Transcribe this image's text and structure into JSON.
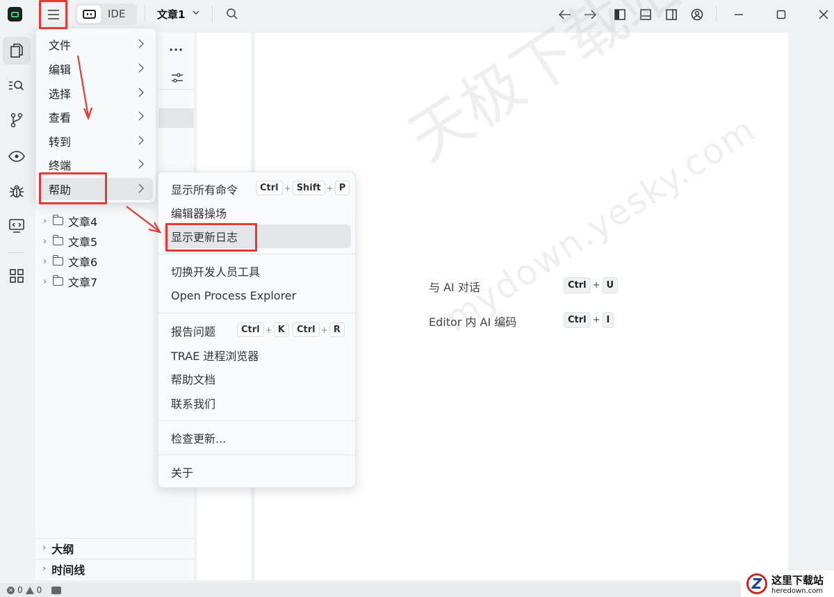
{
  "titlebar": {
    "mode_label": "IDE",
    "file_title": "文章1"
  },
  "main_menu": {
    "items": [
      {
        "label": "文件"
      },
      {
        "label": "编辑"
      },
      {
        "label": "选择"
      },
      {
        "label": "查看"
      },
      {
        "label": "转到"
      },
      {
        "label": "终端"
      },
      {
        "label": "帮助"
      }
    ]
  },
  "help_menu": {
    "items": [
      {
        "label": "显示所有命令",
        "shortcut": [
          "Ctrl",
          "Shift",
          "P"
        ]
      },
      {
        "label": "编辑器操场"
      },
      {
        "label": "显示更新日志"
      },
      {
        "label": "切换开发人员工具"
      },
      {
        "label": "Open Process Explorer"
      },
      {
        "label": "报告问题",
        "shortcut": [
          "Ctrl",
          "K"
        ],
        "shortcut2": [
          "Ctrl",
          "R"
        ]
      },
      {
        "label": "TRAE 进程浏览器"
      },
      {
        "label": "帮助文档"
      },
      {
        "label": "联系我们"
      },
      {
        "label": "检查更新..."
      },
      {
        "label": "关于"
      }
    ]
  },
  "explorer": {
    "tree": [
      {
        "label": "文章4"
      },
      {
        "label": "文章5"
      },
      {
        "label": "文章6"
      },
      {
        "label": "文章7"
      }
    ],
    "sections": [
      {
        "label": "大纲"
      },
      {
        "label": "时间线"
      }
    ]
  },
  "editor": {
    "hints": [
      {
        "label": "与 AI 对话",
        "keys": [
          "Ctrl",
          "U"
        ]
      },
      {
        "label": "Editor 内 AI 编码",
        "keys": [
          "Ctrl",
          "I"
        ]
      }
    ],
    "watermark_main": "天极下载站",
    "watermark_url": "mydown.yesky.com"
  },
  "statusbar": {
    "errors": "0",
    "warnings": "0"
  },
  "corner_logo": {
    "title": "这里下载站",
    "url": "heredown.com"
  },
  "colors": {
    "annotation_red": "#e53935",
    "accent_green": "#32d26e"
  }
}
